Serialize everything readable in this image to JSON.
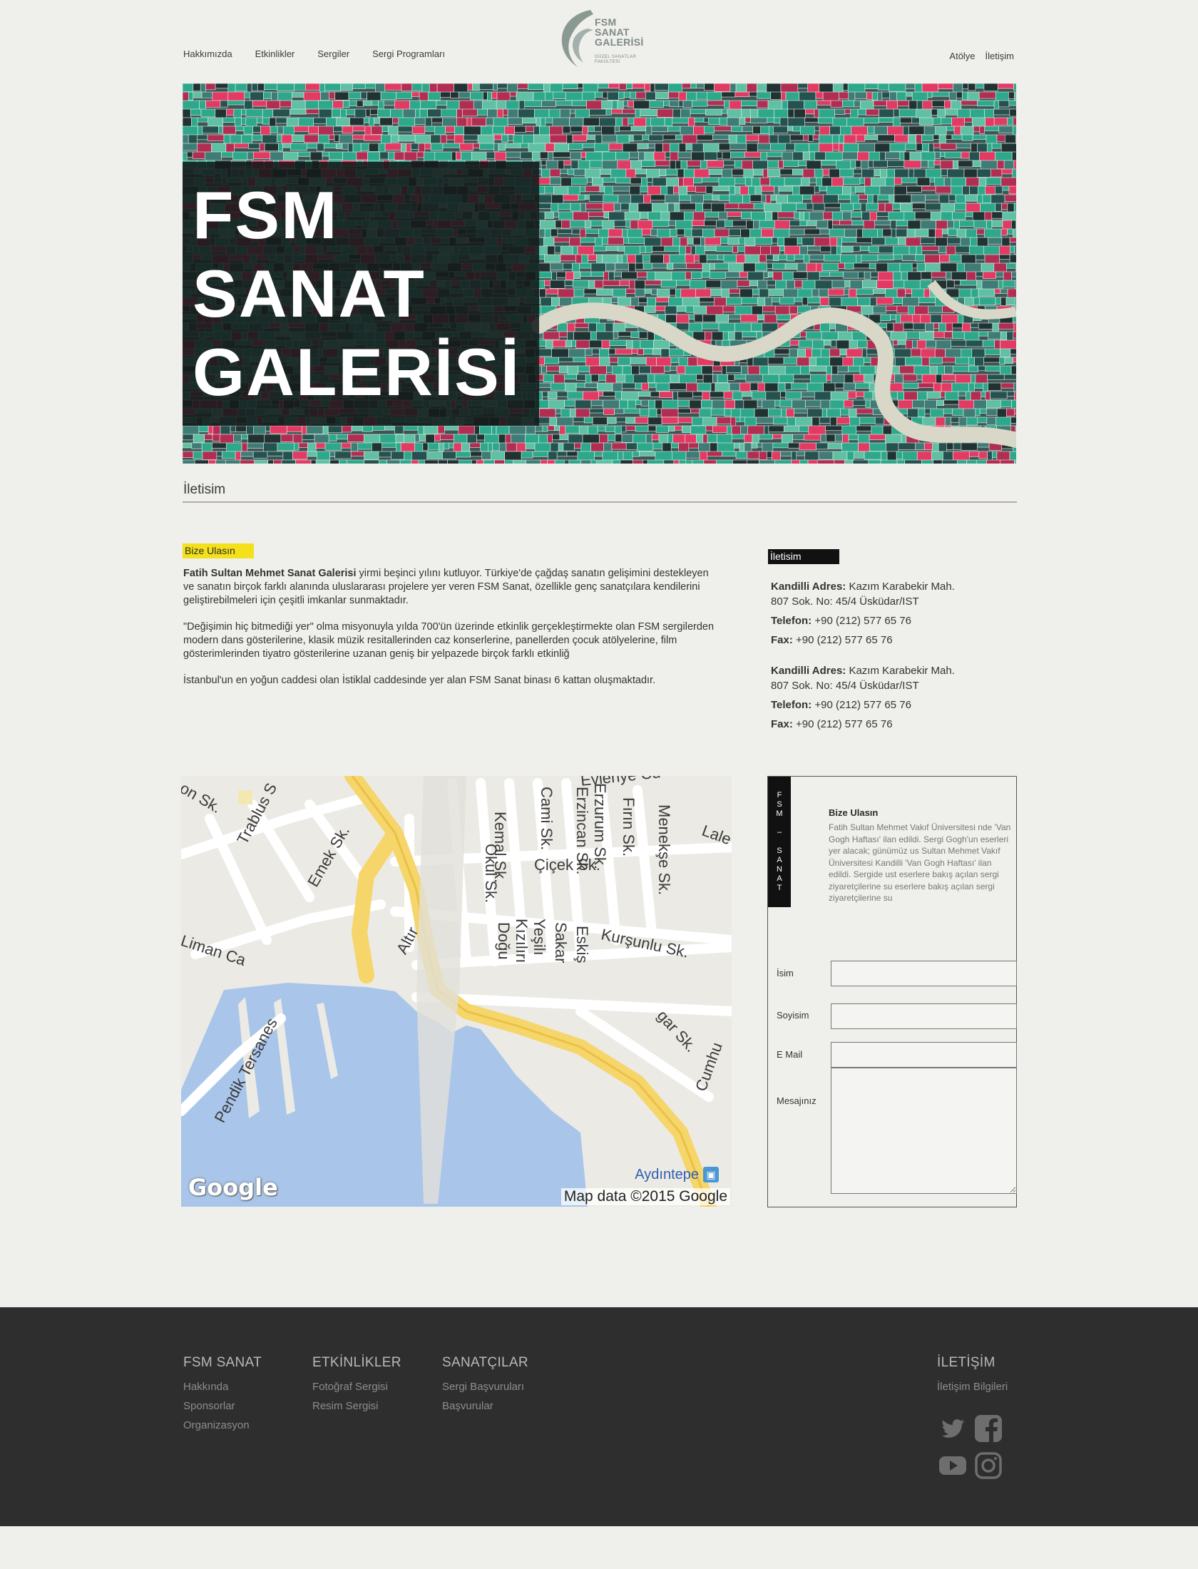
{
  "header": {
    "nav_left": [
      "Hakkımızda",
      "Etkinlikler",
      "Sergiler",
      "Sergi Programları"
    ],
    "nav_right": [
      "Atölye",
      "İletişim"
    ],
    "logo": {
      "line1": "FSM",
      "line2": "SANAT",
      "line3": "GALERİSİ",
      "sub": "GÜZEL SANATLAR FAKÜLTESİ"
    }
  },
  "hero": {
    "title_line1": "FSM",
    "title_line2": "SANAT",
    "title_line3": "GALERİSİ",
    "colors": {
      "green": "#2ea88a",
      "pink": "#e23a63",
      "dark": "#203232",
      "river": "#d9d8c8"
    }
  },
  "section": {
    "title": "İletisim"
  },
  "intro": {
    "badge": "Bize Ulasın",
    "p1_bold": "Fatih Sultan Mehmet Sanat Galerisi",
    "p1_rest": " yirmi beşinci yılını kutluyor. Türkiye'de çağdaş sanatın gelişimini destekleyen ve sanatın birçok farklı alanında uluslararası projelere yer veren FSM Sanat, özellikle genç sanatçılara kendilerini geliştirebilmeleri için çeşitli imkanlar sunmaktadır.",
    "p2": "\"Değişimin hiç bitmediği yer\" olma misyonuyla yılda 700'ün üzerinde etkinlik gerçekleştirmekte olan FSM sergilerden modern dans gösterilerine, klasik müzik resitallerinden caz konserlerine, panellerden çocuk atölyelerine, film gösterimlerinden tiyatro gösterilerine  uzanan geniş bir yelpazede birçok farklı etkinliğ",
    "p3": "İstanbul'un en yoğun caddesi olan İstiklal caddesinde yer alan FSM Sanat binası 6 kattan oluşmaktadır."
  },
  "contact": {
    "badge": "İletisim",
    "blocks": [
      {
        "addr_label": "Kandilli Adres:",
        "addr1": " Kazım Karabekir Mah.",
        "addr2": "807 Sok. No: 45/4 Üsküdar/IST",
        "phone_label": "Telefon:",
        "phone": " +90 (212) 577 65 76",
        "fax_label": "Fax:",
        "fax": " +90 (212) 577 65 76"
      },
      {
        "addr_label": "Kandilli Adres:",
        "addr1": " Kazım Karabekir Mah.",
        "addr2": "807 Sok. No: 45/4 Üsküdar/IST",
        "phone_label": "Telefon:",
        "phone": " +90 (212) 577 65 76",
        "fax_label": "Fax:",
        "fax": " +90 (212) 577 65 76"
      }
    ]
  },
  "map": {
    "streets": [
      "on Sk.",
      "Trablus S",
      "Emek Sk.",
      "Kemal Sk.",
      "Cami Sk.",
      "Erzurum Sk.",
      "Erzincan Sk.",
      "Fırın Sk.",
      "Menekşe Sk.",
      "Lale",
      "Çiçek Sk.",
      "Okul Sk.",
      "Kızılırı",
      "Doğu",
      "Yeşilı",
      "Sakar",
      "Eskiş",
      "Kurşunlu Sk.",
      "Liman Ca",
      "Altır",
      "Pendik Tersanes",
      "gar Sk.",
      "Cumhu",
      "Evlenye Cd"
    ],
    "place": "Aydıntepe",
    "logo": "Google",
    "attribution": "Map data ©2015 Google",
    "colors": {
      "water": "#a9c5ea",
      "road": "#f6d56a",
      "land": "#eceae4"
    }
  },
  "form": {
    "vertical_label": "FSM – SANAT",
    "heading": "Bize Ulasın",
    "body": "Fatih Sultan Mehmet Vakıf Üniversitesi nde 'Van Gogh Haftası' ilan edildi. Sergi Gogh'un eserleri yer alacak; günümüz us Sultan Mehmet Vakıf Üniversitesi Kandilli 'Van Gogh Haftası' ilan edildi. Sergide ust eserlere bakış açılan sergi ziyaretçilerine su eserlere bakış açılan sergi ziyaretçilerine su",
    "labels": {
      "name": "İsim",
      "surname": "Soyisim",
      "email": "E Mail",
      "message": "Mesajınız"
    }
  },
  "footer": {
    "cols": [
      {
        "title": "FSM SANAT",
        "links": [
          "Hakkında",
          "Sponsorlar",
          "Organizasyon"
        ]
      },
      {
        "title": "ETKİNLİKLER",
        "links": [
          "Fotoğraf Sergisi",
          "Resim Sergisi"
        ]
      },
      {
        "title": "SANATÇILAR",
        "links": [
          "Sergi Başvuruları",
          "Başvurular"
        ]
      },
      {
        "title": "İLETİŞİM",
        "links": [
          "İletişim Bilgileri"
        ]
      }
    ],
    "social": [
      "twitter-icon",
      "facebook-icon",
      "youtube-icon",
      "instagram-icon"
    ]
  }
}
